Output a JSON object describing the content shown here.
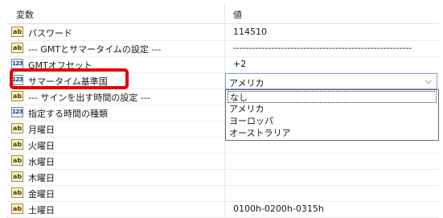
{
  "header": {
    "name_col": "変数",
    "value_col": "値"
  },
  "rows": [
    {
      "icon": "ab",
      "label": "パスワード",
      "value": "114510"
    },
    {
      "icon": "ab",
      "label": "--- GMTとサマータイムの設定 ---",
      "value": "--------------------------------------------------------"
    },
    {
      "icon": "123",
      "label": "GMTオフセット",
      "value": "+2"
    },
    {
      "icon": "123",
      "label": "サマータイム基準国",
      "value": ""
    },
    {
      "icon": "ab",
      "label": "--- サインを出す時間の設定 ---",
      "value": ""
    },
    {
      "icon": "123",
      "label": "指定する時間の種類",
      "value": ""
    },
    {
      "icon": "ab",
      "label": "月曜日",
      "value": ""
    },
    {
      "icon": "ab",
      "label": "火曜日",
      "value": ""
    },
    {
      "icon": "ab",
      "label": "水曜日",
      "value": ""
    },
    {
      "icon": "ab",
      "label": "木曜日",
      "value": ""
    },
    {
      "icon": "ab",
      "label": "金曜日",
      "value": ""
    },
    {
      "icon": "ab",
      "label": "土曜日",
      "value": "0100h-0200h-0315h"
    }
  ],
  "select": {
    "value": "アメリカ",
    "chevron": "⌵"
  },
  "dropdown": {
    "options": [
      "なし",
      "アメリカ",
      "ヨーロッパ",
      "オーストラリア"
    ],
    "selected_index": 0
  },
  "colors": {
    "highlight": "#e60000",
    "focus_border": "#7fa6d9"
  }
}
